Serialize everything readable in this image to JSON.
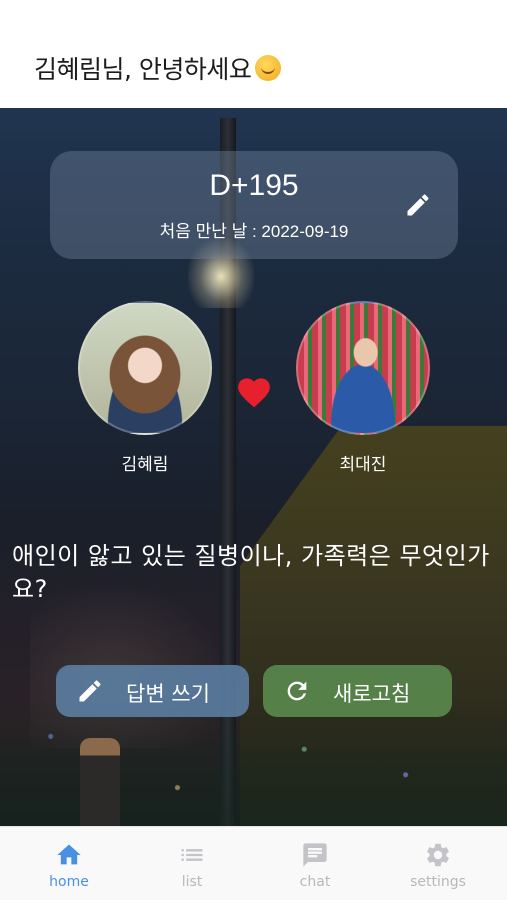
{
  "header": {
    "greeting": "김혜림님, 안녕하세요"
  },
  "dday": {
    "count": "D+195",
    "first_met": "처음 만난 날 : 2022-09-19"
  },
  "couple": {
    "left_name": "김혜림",
    "right_name": "최대진"
  },
  "question": {
    "text": "애인이 앓고 있는 질병이나, 가족력은 무엇인가요?"
  },
  "actions": {
    "answer_label": "답변 쓰기",
    "refresh_label": "새로고침"
  },
  "tabs": [
    {
      "label": "home",
      "icon": "home-icon",
      "active": true
    },
    {
      "label": "list",
      "icon": "list-icon",
      "active": false
    },
    {
      "label": "chat",
      "icon": "chat-icon",
      "active": false
    },
    {
      "label": "settings",
      "icon": "gear-icon",
      "active": false
    }
  ],
  "colors": {
    "active_tab": "#4a90e2",
    "inactive_tab": "#b8b8bc",
    "answer_button": "#5c80a4",
    "refresh_button": "#5a8a4e",
    "heart": "#e8202e"
  }
}
